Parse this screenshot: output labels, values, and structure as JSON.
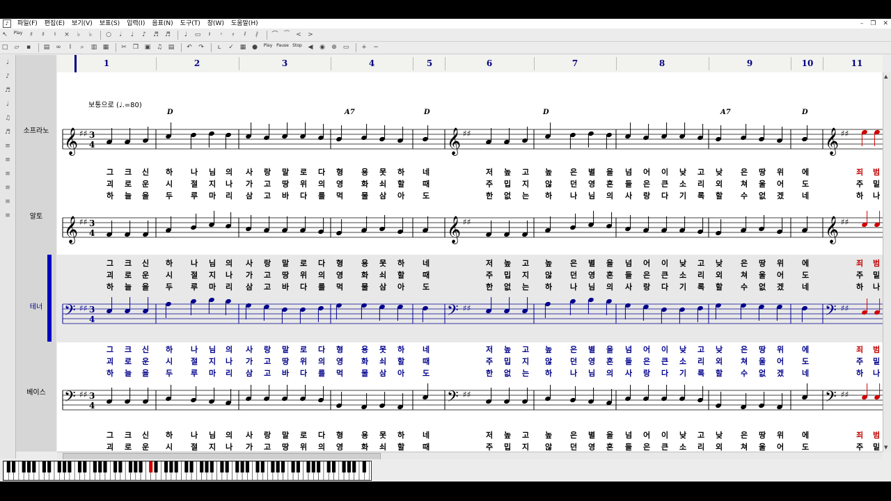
{
  "menu": [
    "파일(F)",
    "편집(E)",
    "보기(V)",
    "보표(S)",
    "입력(I)",
    "음표(N)",
    "도구(T)",
    "창(W)",
    "도움말(H)"
  ],
  "toolbar": {
    "play": "Play",
    "pause": "Pause",
    "stop": "Stop"
  },
  "staves": [
    "소프라노",
    "알토",
    "테너",
    "베이스"
  ],
  "measures": [
    "1",
    "2",
    "3",
    "4",
    "5",
    "6",
    "7",
    "8",
    "9",
    "10",
    "11"
  ],
  "tempo": "보통으로 (♩.=80)",
  "chords": [
    "D",
    "A7",
    "D",
    "D",
    "A7",
    "D"
  ],
  "lyrics": {
    "verse1": [
      "그",
      "크",
      "신",
      "하",
      "나",
      "님",
      "의",
      "사",
      "랑",
      "말",
      "로",
      "다",
      "형",
      "용",
      "못",
      "하",
      "네",
      "저",
      "높",
      "고",
      "높",
      "은",
      "별",
      "을",
      "넘",
      "어",
      "이",
      "낮",
      "고",
      "낮",
      "은",
      "땅",
      "위",
      "에",
      "죄",
      "범"
    ],
    "verse2": [
      "괴",
      "로",
      "운",
      "시",
      "절",
      "지",
      "나",
      "가",
      "고",
      "땅",
      "위",
      "의",
      "영",
      "화",
      "쇠",
      "할",
      "때",
      "주",
      "밉",
      "지",
      "않",
      "던",
      "영",
      "혼",
      "들",
      "은",
      "큰",
      "소",
      "리",
      "외",
      "쳐",
      "울",
      "어",
      "도",
      "주",
      "밑"
    ],
    "verse3": [
      "하",
      "늘",
      "을",
      "두",
      "루",
      "마",
      "리",
      "삼",
      "고",
      "바",
      "다",
      "를",
      "먹",
      "물",
      "삼",
      "아",
      "도",
      "한",
      "없",
      "는",
      "하",
      "나",
      "님",
      "의",
      "사",
      "랑",
      "다",
      "기",
      "록",
      "할",
      "수",
      "없",
      "겠",
      "네",
      "하",
      "나"
    ],
    "tenor_verse1": [
      "그",
      "크",
      "신",
      "하",
      "나",
      "님",
      "의",
      "사",
      "랑",
      "말",
      "로",
      "다",
      "형",
      "용",
      "못",
      "하",
      "네",
      "저",
      "높",
      "고",
      "높",
      "은",
      "별",
      "을",
      "넘",
      "어",
      "이",
      "낮",
      "고",
      "낮",
      "은",
      "땅",
      "위",
      "에",
      "죄",
      "범"
    ],
    "tenor_verse2": [
      "괴",
      "로",
      "운",
      "시",
      "절",
      "지",
      "나",
      "가",
      "고",
      "땅",
      "위",
      "의",
      "영",
      "화",
      "쇠",
      "할",
      "때",
      "주",
      "밉",
      "지",
      "않",
      "던",
      "영",
      "혼",
      "들",
      "은",
      "큰",
      "소",
      "리",
      "외",
      "쳐",
      "울",
      "어",
      "도",
      "주",
      "밑"
    ],
    "tenor_verse3": [
      "하",
      "늘",
      "을",
      "두",
      "루",
      "마",
      "리",
      "삼",
      "고",
      "바",
      "다",
      "를",
      "먹",
      "물",
      "삼",
      "아",
      "도",
      "한",
      "없",
      "는",
      "하",
      "나",
      "님",
      "의",
      "사",
      "랑",
      "다",
      "기",
      "록",
      "할",
      "수",
      "없",
      "겠",
      "네",
      "하",
      "나"
    ]
  }
}
